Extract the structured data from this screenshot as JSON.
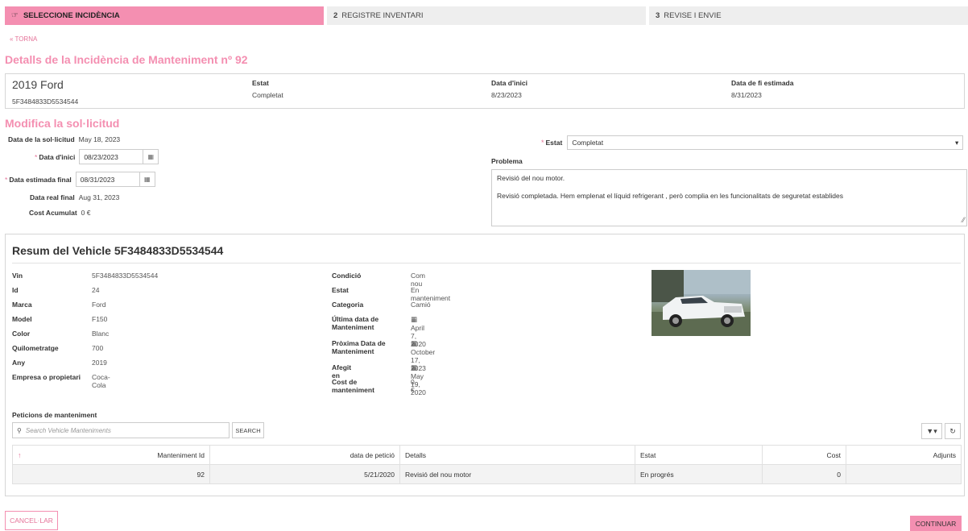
{
  "wizard": {
    "steps": [
      {
        "num": "",
        "label": "SELECCIONE INCIDÈNCIA",
        "active": true
      },
      {
        "num": "2",
        "label": "REGISTRE INVENTARI"
      },
      {
        "num": "3",
        "label": "REVISE I ENVIE"
      }
    ]
  },
  "nav": {
    "back_label": "TORNA"
  },
  "page": {
    "title": "Detalls de la Incidència de Manteniment nº 92"
  },
  "summary": {
    "vehicle_name": "2019 Ford",
    "vin": "5F3484833D5534544",
    "estat_label": "Estat",
    "estat_value": "Completat",
    "start_label": "Data d'inici",
    "start_value": "8/23/2023",
    "end_label": "Data de fi estimada",
    "end_value": "8/31/2023"
  },
  "form": {
    "section_title": "Modifica la sol·licitud",
    "request_date_label": "Data de la sol·licitud",
    "request_date_value": "May 18, 2023",
    "start_label": "Data d'inici",
    "start_value": "08/23/2023",
    "est_end_label": "Data estimada final",
    "est_end_value": "08/31/2023",
    "real_end_label": "Data real final",
    "real_end_value": "Aug 31, 2023",
    "cost_label": "Cost Acumulat",
    "cost_value": "0 €",
    "estat_label": "Estat",
    "estat_value": "Completat",
    "problema_label": "Problema",
    "problema_line1": "Revisió del nou motor.",
    "problema_line2": "Revisió completada. Hem emplenat el líquid refrigerant , però complia en les funcionalitats de seguretat establides"
  },
  "vehicle": {
    "title": "Resum del Vehicle 5F3484833D5534544",
    "left_fields": [
      {
        "k": "Vin",
        "v": "5F3484833D5534544"
      },
      {
        "k": "Id",
        "v": "24"
      },
      {
        "k": "Marca",
        "v": "Ford"
      },
      {
        "k": "Model",
        "v": "F150"
      },
      {
        "k": "Color",
        "v": "Blanc"
      },
      {
        "k": "Quilometratge",
        "v": "700"
      },
      {
        "k": "Any",
        "v": "2019"
      },
      {
        "k": "Empresa o propietari",
        "v": "Coca-Cola"
      }
    ],
    "right_fields": [
      {
        "k": "Condició",
        "v": "Com nou"
      },
      {
        "k": "Estat",
        "v": "En manteniment"
      },
      {
        "k": "Categoria",
        "v": "Camió"
      },
      {
        "k": "Última data de Manteniment",
        "v": "April 7, 2020"
      },
      {
        "k": "Pròxima Data de Manteniment",
        "v": "October 17, 2023"
      },
      {
        "k": "Afegit en",
        "v": "May 19, 2020"
      },
      {
        "k": "Cost de manteniment",
        "v": "0 €"
      }
    ]
  },
  "maintenance": {
    "title": "Peticions de manteniment",
    "search_placeholder": "Search Vehicle Manteniments",
    "search_button": "SEARCH",
    "columns": [
      "Manteniment Id",
      "data de petició",
      "Detalls",
      "Estat",
      "Cost",
      "Adjunts"
    ],
    "rows": [
      [
        "92",
        "5/21/2020",
        "Revisió del nou motor",
        "En progrés",
        "0",
        ""
      ]
    ]
  },
  "actions": {
    "cancel_label": "CANCEL·LAR",
    "continue_label": "CONTINUAR"
  },
  "colors": {
    "accent": "#f48fb1",
    "accent_text": "#e57399"
  }
}
